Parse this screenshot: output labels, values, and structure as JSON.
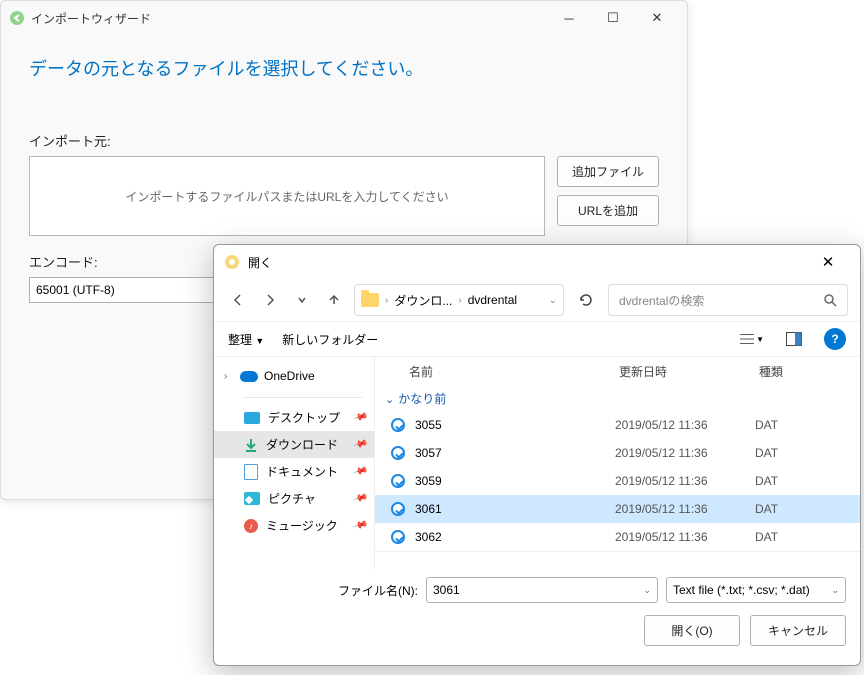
{
  "wizard": {
    "title": "インポートウィザード",
    "heading": "データの元となるファイルを選択してください。",
    "import_from_label": "インポート元:",
    "import_placeholder": "インポートするファイルパスまたはURLを入力してください",
    "add_file": "追加ファイル",
    "add_url": "URLを追加",
    "encoding_label": "エンコード:",
    "encoding_value": "65001 (UTF-8)"
  },
  "dialog": {
    "title": "開く",
    "breadcrumb": {
      "part1": "ダウンロ...",
      "part2": "dvdrental"
    },
    "search_placeholder": "dvdrentalの検索",
    "toolbar": {
      "organize": "整理",
      "new_folder": "新しいフォルダー"
    },
    "sidebar": {
      "onedrive": "OneDrive",
      "items": [
        {
          "label": "デスクトップ"
        },
        {
          "label": "ダウンロード"
        },
        {
          "label": "ドキュメント"
        },
        {
          "label": "ピクチャ"
        },
        {
          "label": "ミュージック"
        }
      ]
    },
    "columns": {
      "name": "名前",
      "date": "更新日時",
      "type": "種類"
    },
    "group": "かなり前",
    "files": [
      {
        "name": "3055",
        "date": "2019/05/12 11:36",
        "type": "DAT"
      },
      {
        "name": "3057",
        "date": "2019/05/12 11:36",
        "type": "DAT"
      },
      {
        "name": "3059",
        "date": "2019/05/12 11:36",
        "type": "DAT"
      },
      {
        "name": "3061",
        "date": "2019/05/12 11:36",
        "type": "DAT"
      },
      {
        "name": "3062",
        "date": "2019/05/12 11:36",
        "type": "DAT"
      }
    ],
    "selected_index": 3,
    "filename_label": "ファイル名(N):",
    "filename_value": "3061",
    "filetype_value": "Text file (*.txt; *.csv; *.dat)",
    "open_button": "開く(O)",
    "cancel_button": "キャンセル"
  }
}
